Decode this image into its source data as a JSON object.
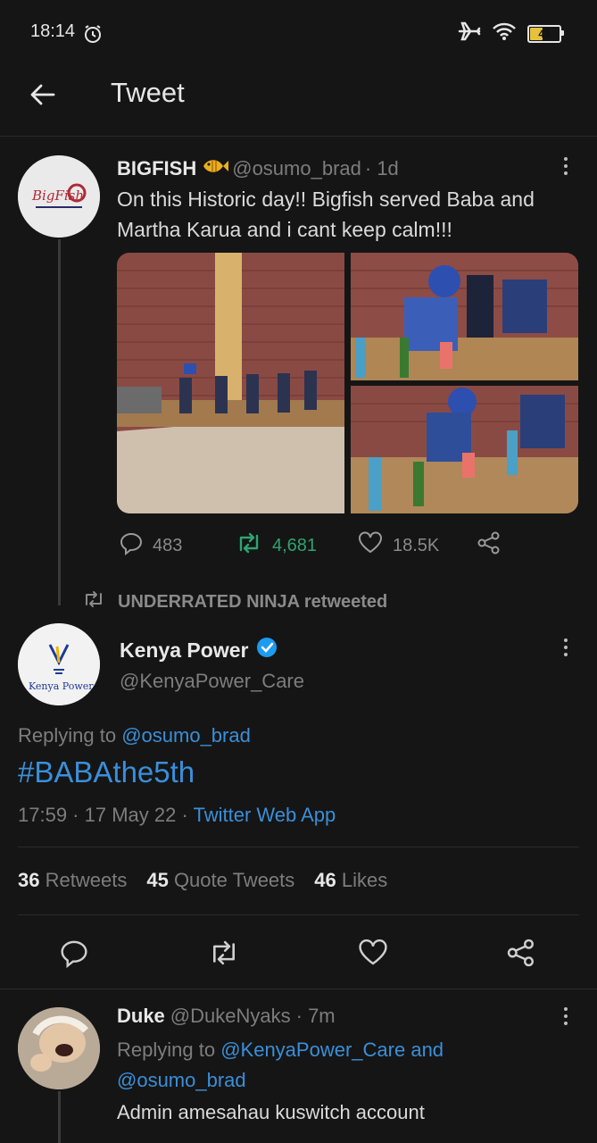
{
  "status": {
    "time": "18:14",
    "battery": "43"
  },
  "header": {
    "title": "Tweet"
  },
  "tweet1": {
    "name": "BIGFISH",
    "handle": "@osumo_brad",
    "time": "· 1d",
    "avatar_text": "BigFish",
    "text": "On this Historic day!! Bigfish served Baba and Martha Karua and i cant keep calm!!!",
    "replies": "483",
    "retweets": "4,681",
    "likes": "18.5K"
  },
  "retweet_banner": "UNDERRATED NINJA retweeted",
  "main_tweet": {
    "name": "Kenya Power",
    "handle": "@KenyaPower_Care",
    "avatar_text": "Kenya Power",
    "replying_prefix": "Replying to",
    "replying_handle": "@osumo_brad",
    "hashtag": "#BABAthe5th",
    "timestamp": "17:59 · 17 May 22 ·",
    "source": "Twitter Web App",
    "stats": {
      "retweets_count": "36",
      "retweets_label": "Retweets",
      "quotes_count": "45",
      "quotes_label": "Quote Tweets",
      "likes_count": "46",
      "likes_label": "Likes"
    }
  },
  "reply": {
    "name": "Duke",
    "handle": "@DukeNyaks",
    "time": "· 7m",
    "replying_prefix": "Replying to",
    "replying_handle1": "@KenyaPower_Care",
    "replying_and": "and",
    "replying_handle2": "@osumo_brad",
    "text": "Admin amesahau kuswitch account"
  },
  "colors": {
    "background": "#151515",
    "link": "#3a8fd9",
    "retweet_green": "#2fa370",
    "verified": "#1d9bf0"
  }
}
